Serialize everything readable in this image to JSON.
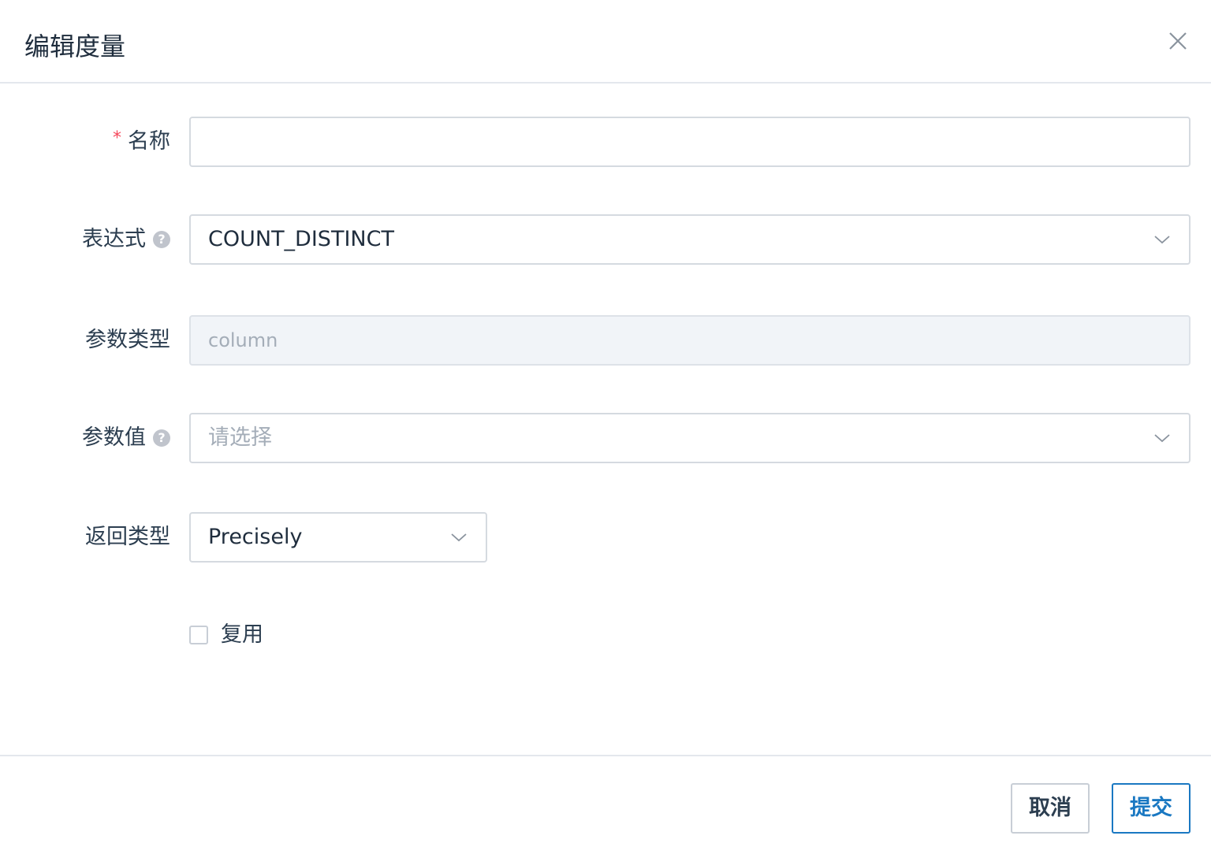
{
  "dialog": {
    "title": "编辑度量"
  },
  "form": {
    "name": {
      "required_mark": "*",
      "label": "名称",
      "value": ""
    },
    "expression": {
      "label": "表达式",
      "help": "?",
      "value": "COUNT_DISTINCT"
    },
    "param_type": {
      "label": "参数类型",
      "value": "column"
    },
    "param_value": {
      "label": "参数值",
      "help": "?",
      "placeholder": "请选择"
    },
    "return_type": {
      "label": "返回类型",
      "value": "Precisely"
    },
    "reuse": {
      "label": "复用",
      "checked": false
    }
  },
  "footer": {
    "cancel_label": "取消",
    "submit_label": "提交"
  },
  "colors": {
    "primary": "#1a78c2",
    "required": "#f5475b",
    "border": "#d5dae0",
    "disabled_bg": "#f1f4f8"
  }
}
